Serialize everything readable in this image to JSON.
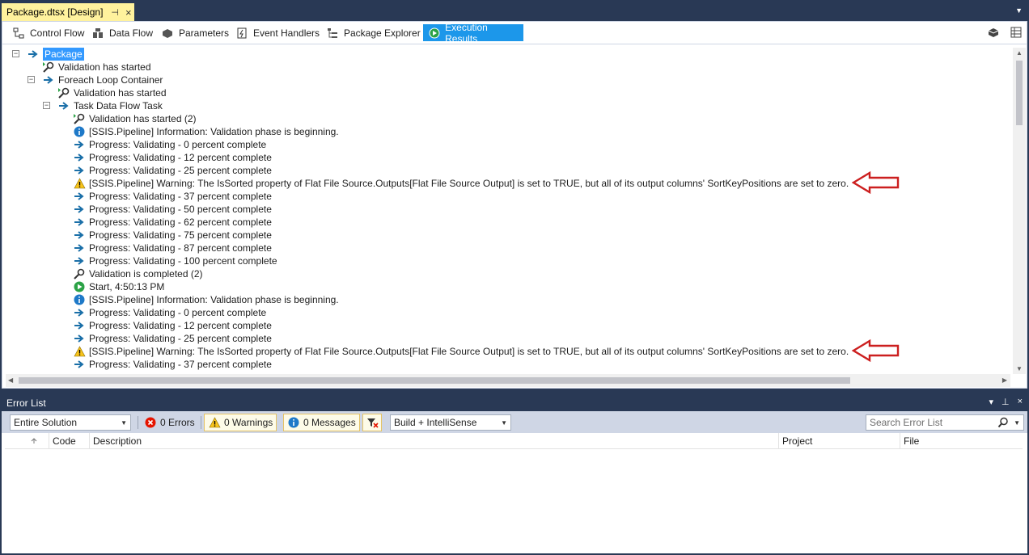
{
  "document_tab": {
    "title": "Package.dtsx [Design]",
    "pin_icon": "pin-icon",
    "close_icon": "close-icon"
  },
  "designer_tabs": [
    {
      "label": "Control Flow",
      "icon": "control-flow-icon"
    },
    {
      "label": "Data Flow",
      "icon": "data-flow-icon"
    },
    {
      "label": "Parameters",
      "icon": "parameters-icon"
    },
    {
      "label": "Event Handlers",
      "icon": "event-handlers-icon"
    },
    {
      "label": "Package Explorer",
      "icon": "package-explorer-icon"
    },
    {
      "label": "Execution Results",
      "icon": "execution-results-icon",
      "active": true
    }
  ],
  "execution_results": [
    {
      "text": "Package",
      "icon": "arrow",
      "level": 0,
      "expander": "−",
      "selected": true
    },
    {
      "text": "Validation has started",
      "icon": "validate",
      "level": 1
    },
    {
      "text": "Foreach Loop Container",
      "icon": "arrow",
      "level": 1,
      "expander": "−"
    },
    {
      "text": "Validation has started",
      "icon": "validate",
      "level": 2
    },
    {
      "text": "Task Data Flow Task",
      "icon": "arrow",
      "level": 2,
      "expander": "−"
    },
    {
      "text": "Validation has started (2)",
      "icon": "validate",
      "level": 3
    },
    {
      "text": "[SSIS.Pipeline] Information: Validation phase is beginning.",
      "icon": "info",
      "level": 3
    },
    {
      "text": "Progress: Validating - 0 percent complete",
      "icon": "arrow",
      "level": 3
    },
    {
      "text": "Progress: Validating - 12 percent complete",
      "icon": "arrow",
      "level": 3
    },
    {
      "text": "Progress: Validating - 25 percent complete",
      "icon": "arrow",
      "level": 3
    },
    {
      "text": "[SSIS.Pipeline] Warning: The IsSorted property of Flat File Source.Outputs[Flat File Source Output] is set to TRUE, but all of its output columns' SortKeyPositions are set to zero.",
      "icon": "warning",
      "level": 3,
      "annotated": true
    },
    {
      "text": "Progress: Validating - 37 percent complete",
      "icon": "arrow",
      "level": 3
    },
    {
      "text": "Progress: Validating - 50 percent complete",
      "icon": "arrow",
      "level": 3
    },
    {
      "text": "Progress: Validating - 62 percent complete",
      "icon": "arrow",
      "level": 3
    },
    {
      "text": "Progress: Validating - 75 percent complete",
      "icon": "arrow",
      "level": 3
    },
    {
      "text": "Progress: Validating - 87 percent complete",
      "icon": "arrow",
      "level": 3
    },
    {
      "text": "Progress: Validating - 100 percent complete",
      "icon": "arrow",
      "level": 3
    },
    {
      "text": "Validation is completed (2)",
      "icon": "validate-done",
      "level": 3
    },
    {
      "text": "Start, 4:50:13 PM",
      "icon": "start",
      "level": 3
    },
    {
      "text": "[SSIS.Pipeline] Information: Validation phase is beginning.",
      "icon": "info",
      "level": 3
    },
    {
      "text": "Progress: Validating - 0 percent complete",
      "icon": "arrow",
      "level": 3
    },
    {
      "text": "Progress: Validating - 12 percent complete",
      "icon": "arrow",
      "level": 3
    },
    {
      "text": "Progress: Validating - 25 percent complete",
      "icon": "arrow",
      "level": 3
    },
    {
      "text": "[SSIS.Pipeline] Warning: The IsSorted property of Flat File Source.Outputs[Flat File Source Output] is set to TRUE, but all of its output columns' SortKeyPositions are set to zero.",
      "icon": "warning",
      "level": 3,
      "annotated": true
    },
    {
      "text": "Progress: Validating - 37 percent complete",
      "icon": "arrow",
      "level": 3
    }
  ],
  "error_list": {
    "title": "Error List",
    "scope": "Entire Solution",
    "errors_label": "0 Errors",
    "warnings_label": "0 Warnings",
    "messages_label": "0 Messages",
    "build_filter": "Build + IntelliSense",
    "search_placeholder": "Search Error List",
    "columns": {
      "code": "Code",
      "description": "Description",
      "project": "Project",
      "file": "File"
    }
  },
  "colors": {
    "chrome": "#293955",
    "active_tab": "#1c97ea",
    "doc_tab": "#fff29d",
    "annotation_arrow": "#cc1f1f",
    "selection": "#3399ff"
  }
}
